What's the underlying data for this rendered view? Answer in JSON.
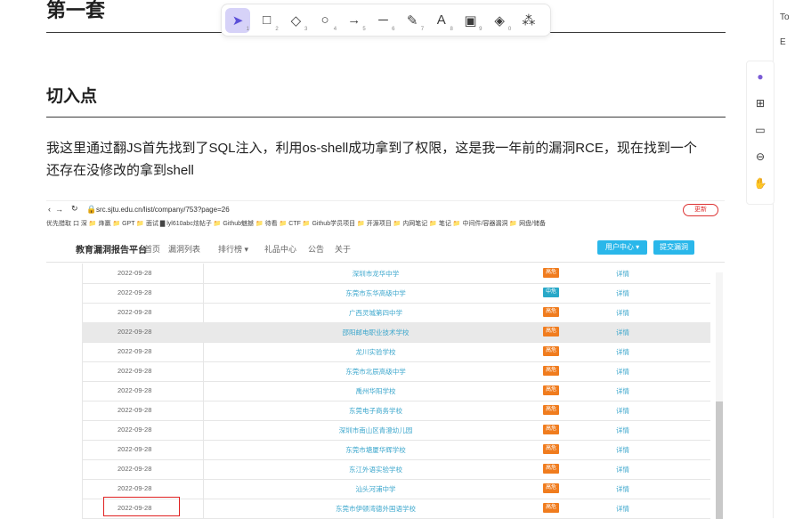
{
  "doc": {
    "heading1": "第一套",
    "heading2": "切入点",
    "paragraph": "我这里通过翻JS首先找到了SQL注入，利用os-shell成功拿到了权限，这是我一年前的漏洞RCE，现在找到一个还存在没修改的拿到shell"
  },
  "toolbar": {
    "tools": [
      {
        "icon": "cursor-icon",
        "glyph": "➤",
        "num": "1",
        "active": true
      },
      {
        "icon": "rectangle-icon",
        "glyph": "□",
        "num": "2"
      },
      {
        "icon": "diamond-icon",
        "glyph": "◇",
        "num": "3"
      },
      {
        "icon": "circle-icon",
        "glyph": "○",
        "num": "4"
      },
      {
        "icon": "arrow-icon",
        "glyph": "→",
        "num": "5"
      },
      {
        "icon": "line-icon",
        "glyph": "─",
        "num": "6"
      },
      {
        "icon": "pencil-icon",
        "glyph": "✎",
        "num": "7"
      },
      {
        "icon": "text-icon",
        "glyph": "A",
        "num": "8"
      },
      {
        "icon": "image-icon",
        "glyph": "▣",
        "num": "9"
      },
      {
        "icon": "eraser-icon",
        "glyph": "◈",
        "num": "0"
      },
      {
        "icon": "shapes-icon",
        "glyph": "⁂",
        "num": ""
      }
    ]
  },
  "right_panel": {
    "text1": "To",
    "text2": "E"
  },
  "browser": {
    "url": "src.sjtu.edu.cn/list/company/753?page=26",
    "update_label": "更新",
    "bookmarks": "优先猎取  口 深  📁 烽赢  📁 GPT  📁 面试  ▇ lyl610abc炫帖子  📁 Github魅撼  📁 待看  📁 CTF  📁 Github学员项目  📁 开源项目  📁 内网笔记  📁 笔记  📁 中间件/容器漏洞  📁 网盘/储备"
  },
  "site": {
    "brand": "教育漏洞报告平台",
    "nav": [
      "首页",
      "漏洞列表",
      "排行榜 ▾",
      "礼品中心",
      "公告",
      "关于"
    ],
    "user_btn": "用户中心 ▾",
    "submit_btn": "提交漏洞"
  },
  "table": {
    "rows": [
      {
        "date": "2022-09-28",
        "school": "深圳市龙华中学",
        "level": "高危",
        "color": "#f07c1e",
        "action": "详情"
      },
      {
        "date": "2022-09-28",
        "school": "东莞市东华高级中学",
        "level": "中危",
        "color": "#28a8c8",
        "action": "详情"
      },
      {
        "date": "2022-09-28",
        "school": "广西灵城第四中学",
        "level": "高危",
        "color": "#f07c1e",
        "action": "详情"
      },
      {
        "date": "2022-09-28",
        "school": "邵阳邮电职业技术学校",
        "level": "高危",
        "color": "#f07c1e",
        "action": "详情",
        "hl": true
      },
      {
        "date": "2022-09-28",
        "school": "龙川实验学校",
        "level": "高危",
        "color": "#f07c1e",
        "action": "详情"
      },
      {
        "date": "2022-09-28",
        "school": "东莞市北辰高级中学",
        "level": "高危",
        "color": "#f07c1e",
        "action": "详情"
      },
      {
        "date": "2022-09-28",
        "school": "禹州华阳学校",
        "level": "高危",
        "color": "#f07c1e",
        "action": "详情"
      },
      {
        "date": "2022-09-28",
        "school": "东莞电子商务学校",
        "level": "高危",
        "color": "#f07c1e",
        "action": "详情"
      },
      {
        "date": "2022-09-28",
        "school": "深圳市南山区青澄幼儿园",
        "level": "高危",
        "color": "#f07c1e",
        "action": "详情"
      },
      {
        "date": "2022-09-28",
        "school": "东莞市塘厦华辉学校",
        "level": "高危",
        "color": "#f07c1e",
        "action": "详情"
      },
      {
        "date": "2022-09-28",
        "school": "东江外语实验学校",
        "level": "高危",
        "color": "#f07c1e",
        "action": "详情"
      },
      {
        "date": "2022-09-28",
        "school": "汕头河浦中学",
        "level": "高危",
        "color": "#f07c1e",
        "action": "详情"
      },
      {
        "date": "2022-09-28",
        "school": "东莞市伊顿湾德外国语学校",
        "level": "高危",
        "color": "#f07c1e",
        "action": "详情"
      }
    ]
  }
}
